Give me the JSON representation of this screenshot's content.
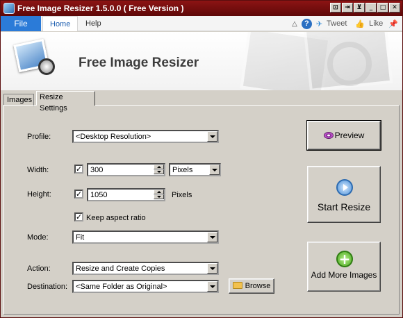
{
  "window": {
    "title": "Free Image Resizer 1.5.0.0 ( Free Version )"
  },
  "ribbon": {
    "file_label": "File",
    "tabs": [
      "Home",
      "Help"
    ],
    "tweet_label": "Tweet",
    "like_label": "Like"
  },
  "header": {
    "app_name": "Free Image Resizer"
  },
  "content_tabs": [
    "Images",
    "Resize Settings"
  ],
  "form": {
    "profile_label": "Profile:",
    "profile_value": "<Desktop Resolution>",
    "width_label": "Width:",
    "width_checked": true,
    "width_value": "300",
    "width_unit": "Pixels",
    "height_label": "Height:",
    "height_checked": true,
    "height_value": "1050",
    "height_unit": "Pixels",
    "keep_aspect_label": "Keep aspect ratio",
    "keep_aspect_checked": true,
    "mode_label": "Mode:",
    "mode_value": "Fit",
    "action_label": "Action:",
    "action_value": "Resize and Create Copies",
    "destination_label": "Destination:",
    "destination_value": "<Same Folder as Original>",
    "browse_label": "Browse"
  },
  "actions": {
    "preview_label": "Preview",
    "start_label": "Start Resize",
    "add_label": "Add More Images"
  }
}
